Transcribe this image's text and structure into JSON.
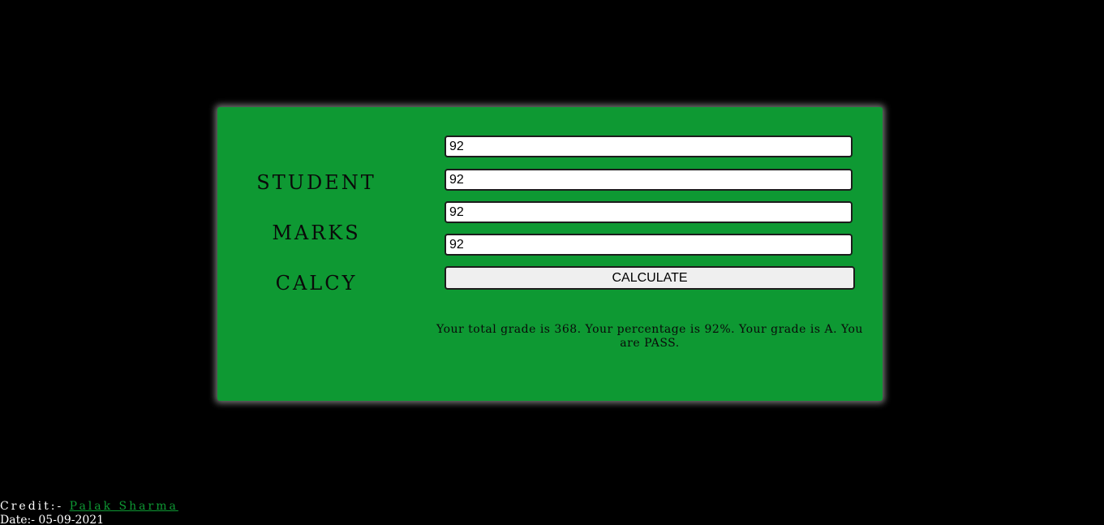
{
  "title": {
    "line1": "STUDENT",
    "line2": "MARKS",
    "line3": "CALCY"
  },
  "inputs": {
    "mark1": "92",
    "mark2": "92",
    "mark3": "92",
    "mark4": "92"
  },
  "button": {
    "label": "CALCULATE"
  },
  "result": {
    "text": "Your total grade is 368. Your percentage is 92%. Your grade is A. You are PASS."
  },
  "footer": {
    "credit_label": "Credit:- ",
    "credit_name": "Palak Sharma",
    "date": "Date:- 05-09-2021"
  },
  "colors": {
    "background": "#000000",
    "card": "#0e9933",
    "link": "#0e9933"
  }
}
